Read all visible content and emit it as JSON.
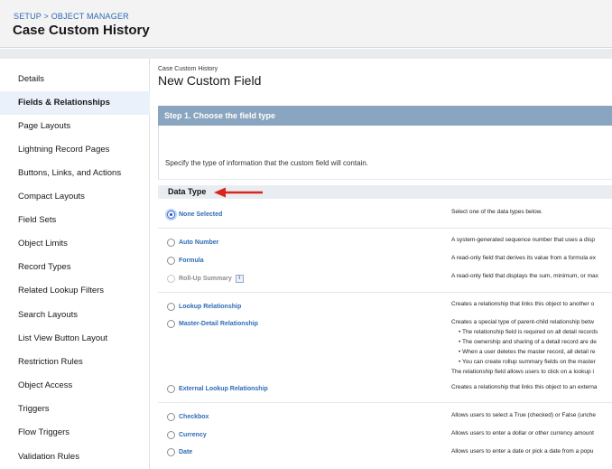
{
  "header": {
    "breadcrumb_setup": "SETUP",
    "breadcrumb_sep": " > ",
    "breadcrumb_object_manager": "OBJECT MANAGER",
    "title": "Case Custom History"
  },
  "sidebar": {
    "items": [
      {
        "label": "Details"
      },
      {
        "label": "Fields & Relationships"
      },
      {
        "label": "Page Layouts"
      },
      {
        "label": "Lightning Record Pages"
      },
      {
        "label": "Buttons, Links, and Actions"
      },
      {
        "label": "Compact Layouts"
      },
      {
        "label": "Field Sets"
      },
      {
        "label": "Object Limits"
      },
      {
        "label": "Record Types"
      },
      {
        "label": "Related Lookup Filters"
      },
      {
        "label": "Search Layouts"
      },
      {
        "label": "List View Button Layout"
      },
      {
        "label": "Restriction Rules"
      },
      {
        "label": "Object Access"
      },
      {
        "label": "Triggers"
      },
      {
        "label": "Flow Triggers"
      },
      {
        "label": "Validation Rules"
      }
    ],
    "active": "Fields & Relationships"
  },
  "main": {
    "object_label": "Case Custom History",
    "title": "New Custom Field",
    "step_title": "Step 1. Choose the field type",
    "step_description": "Specify the type of information that the custom field will contain.",
    "data_type_header": "Data Type",
    "options": [
      {
        "label": "None Selected",
        "description": "Select one of the data types below.",
        "selected": true
      },
      {
        "label": "Auto Number",
        "description": "A system-generated sequence number that uses a disp"
      },
      {
        "label": "Formula",
        "description": "A read-only field that derives its value from a formula ex"
      },
      {
        "label": "Roll-Up Summary",
        "description": "A read-only field that displays the sum, minimum, or max",
        "disabled": true
      },
      {
        "label": "Lookup Relationship",
        "description": "Creates a relationship that links this object to another o"
      },
      {
        "label": "Master-Detail Relationship",
        "description": "Creates a special type of parent-child relationship betw",
        "bullets": [
          "The relationship field is required on all detail records",
          "The ownership and sharing of a detail record are de",
          "When a user deletes the master record, all detail re",
          "You can create rollup summary fields on the master"
        ],
        "footer": "The relationship field allows users to click on a lookup i"
      },
      {
        "label": "External Lookup Relationship",
        "description": "Creates a relationship that links this object to an externa"
      },
      {
        "label": "Checkbox",
        "description": "Allows users to select a True (checked) or False (unche"
      },
      {
        "label": "Currency",
        "description": "Allows users to enter a dollar or other currency amount"
      },
      {
        "label": "Date",
        "description": "Allows users to enter a date or pick a date from a popu"
      }
    ]
  },
  "colors": {
    "link": "#2e6cb5",
    "step_bar": "#8aa5bf",
    "active_sidebar": "#ebf1fb",
    "arrow": "#d7261e"
  }
}
